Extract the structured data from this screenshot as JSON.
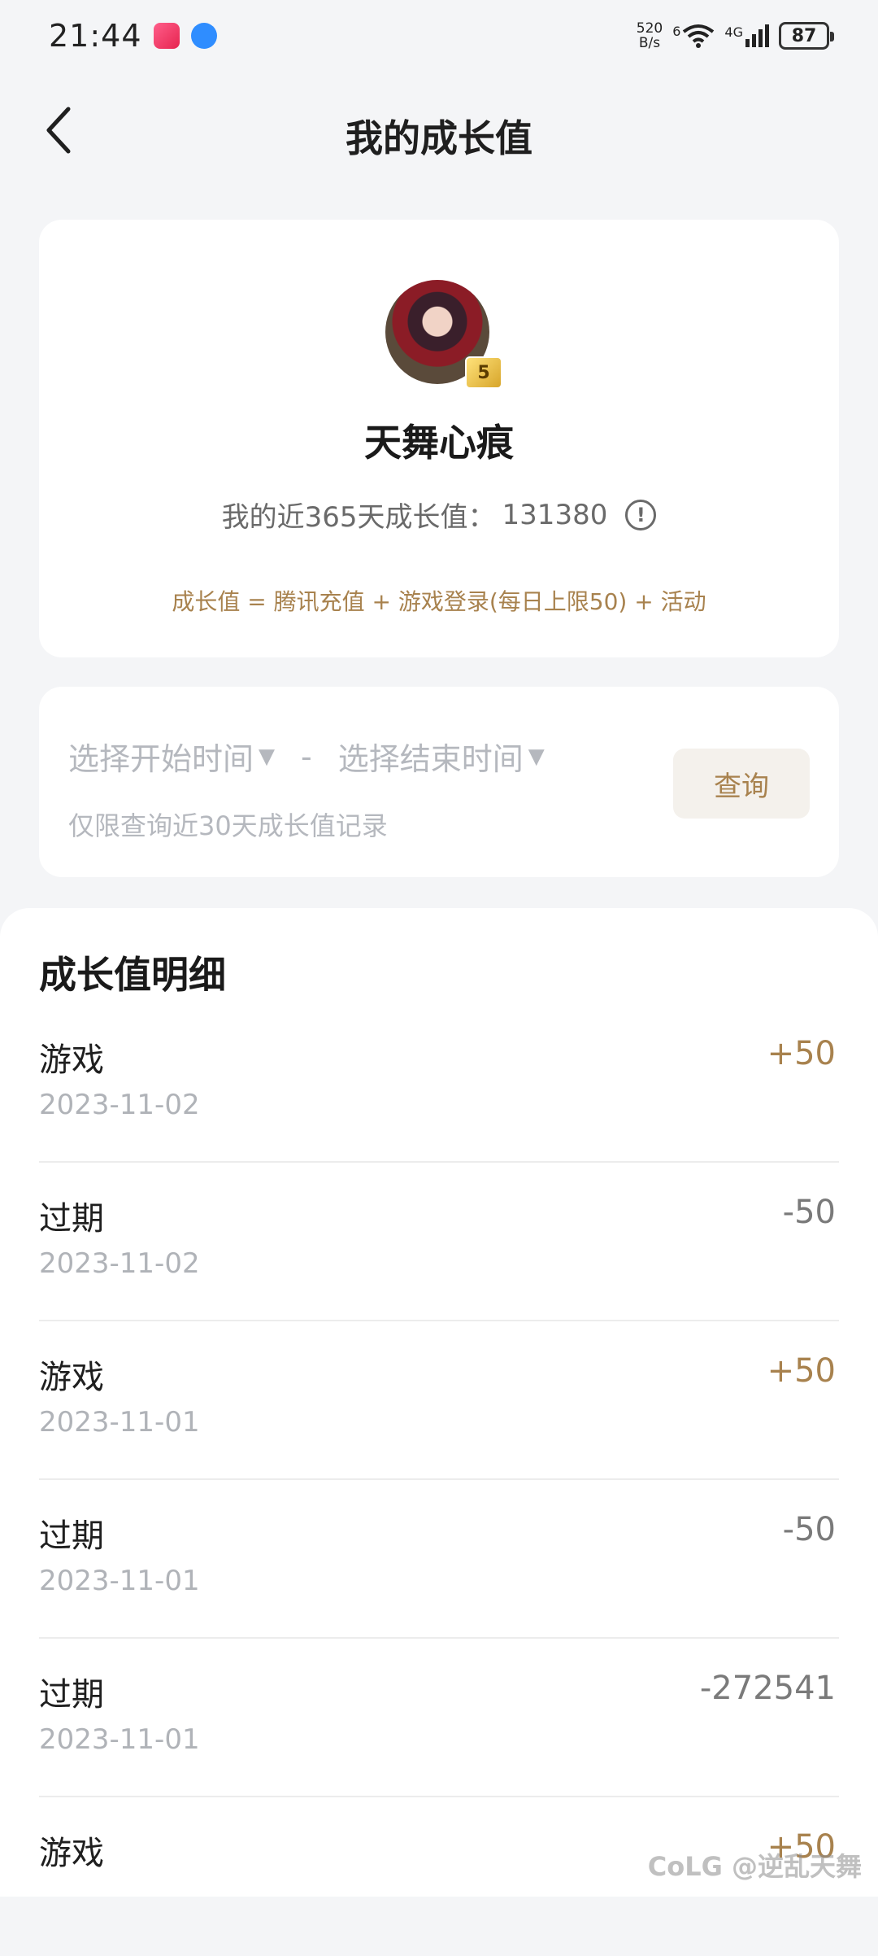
{
  "status_bar": {
    "time": "21:44",
    "net_speed_value": "520",
    "net_speed_unit": "B/s",
    "wifi_label": "6",
    "cell_label": "4G",
    "battery": "87"
  },
  "nav": {
    "title": "我的成长值"
  },
  "profile": {
    "nickname": "天舞心痕",
    "vip_badge": "5",
    "growth_label": "我的近365天成长值：",
    "growth_value": "131380",
    "formula": "成长值 = 腾讯充值 + 游戏登录(每日上限50) + 活动"
  },
  "query": {
    "start_placeholder": "选择开始时间",
    "separator": "-",
    "end_placeholder": "选择结束时间",
    "hint": "仅限查询近30天成长值记录",
    "button_label": "查询"
  },
  "detail": {
    "title": "成长值明细",
    "records": [
      {
        "type": "游戏",
        "date": "2023-11-02",
        "value": "+50"
      },
      {
        "type": "过期",
        "date": "2023-11-02",
        "value": "-50"
      },
      {
        "type": "游戏",
        "date": "2023-11-01",
        "value": "+50"
      },
      {
        "type": "过期",
        "date": "2023-11-01",
        "value": "-50"
      },
      {
        "type": "过期",
        "date": "2023-11-01",
        "value": "-272541"
      },
      {
        "type": "游戏",
        "date": "",
        "value": "+50"
      }
    ]
  },
  "watermark": "CoLG @逆乱天舞",
  "colors": {
    "accent_gold": "#a8824e",
    "negative_gray": "#7a7a7a",
    "background": "#f4f5f7"
  }
}
